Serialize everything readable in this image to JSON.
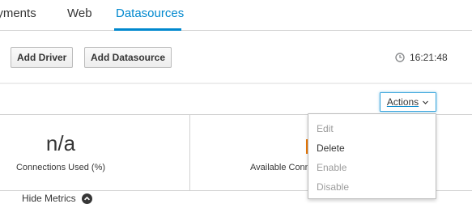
{
  "tabs": [
    {
      "label": "oyments"
    },
    {
      "label": "Web"
    },
    {
      "label": "Datasources",
      "active": true
    }
  ],
  "toolbar": {
    "add_driver_label": "Add Driver",
    "add_datasource_label": "Add Datasource",
    "clock_time": "16:21:48"
  },
  "actions": {
    "button_label": "Actions",
    "menu_items": [
      {
        "label": "Edit",
        "enabled": false
      },
      {
        "label": "Delete",
        "enabled": true
      },
      {
        "label": "Enable",
        "enabled": false
      },
      {
        "label": "Disable",
        "enabled": false
      }
    ]
  },
  "metrics": {
    "connections_used_value": "n/a",
    "connections_used_label": "Connections Used (%)",
    "available_connections_label": "Available Connections"
  },
  "footer": {
    "hide_metrics_label": "Hide Metrics"
  },
  "colors": {
    "accent": "#0088ce",
    "focus_border": "#39a5dc",
    "disabled_text": "#9c9c9c",
    "orange": "#ec7a08"
  },
  "icons": {
    "clock": "clock-icon",
    "chevron_up": "chevron-up-circle-icon",
    "chevron_down": "chevron-down-icon"
  }
}
